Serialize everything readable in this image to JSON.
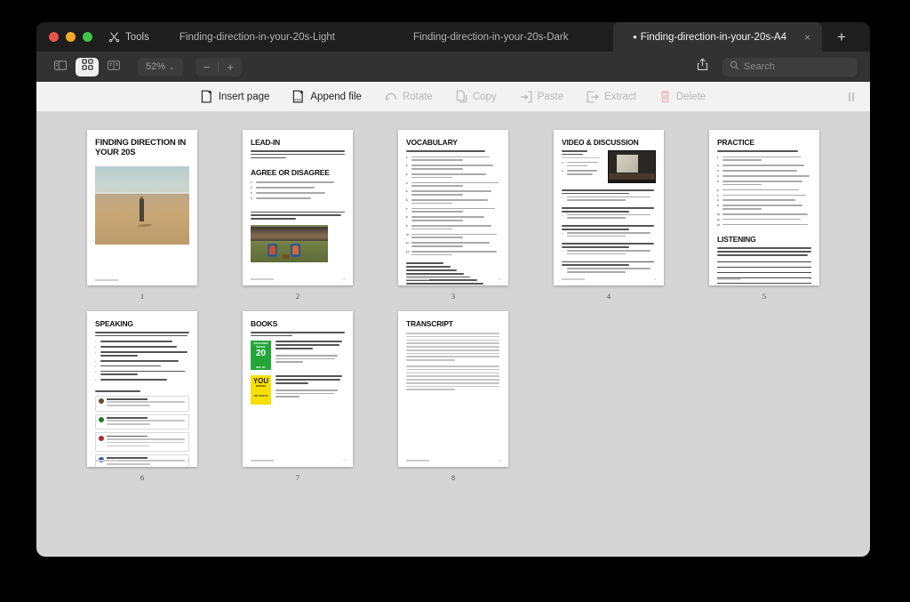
{
  "window": {
    "traffic_lights": [
      "close",
      "minimize",
      "maximize"
    ],
    "tools_label": "Tools"
  },
  "tabs": [
    {
      "label": "Finding-direction-in-your-20s-Light",
      "active": false,
      "dirty": false
    },
    {
      "label": "Finding-direction-in-your-20s-Dark",
      "active": false,
      "dirty": false
    },
    {
      "label": "Finding-direction-in-your-20s-A4",
      "active": true,
      "dirty": true,
      "dirty_marker": "•",
      "close_glyph": "×"
    }
  ],
  "new_tab_label": "+",
  "toolbar": {
    "sidebar_icon": "sidebar-icon",
    "grid_icon": "thumbnail-grid-icon",
    "split_icon": "split-view-icon",
    "zoom_level": "52%",
    "zoom_chevron": "⌄",
    "zoom_out": "−",
    "zoom_in": "+",
    "share_icon": "share-icon",
    "search_placeholder": "Search",
    "search_value": ""
  },
  "edit_toolbar": {
    "items": [
      {
        "label": "Insert page",
        "icon": "insert-page-icon",
        "enabled": true
      },
      {
        "label": "Append file",
        "icon": "append-file-icon",
        "enabled": true
      },
      {
        "label": "Rotate",
        "icon": "rotate-icon",
        "enabled": false
      },
      {
        "label": "Copy",
        "icon": "copy-icon",
        "enabled": false
      },
      {
        "label": "Paste",
        "icon": "paste-icon",
        "enabled": false
      },
      {
        "label": "Extract",
        "icon": "extract-icon",
        "enabled": false
      },
      {
        "label": "Delete",
        "icon": "trash-icon",
        "enabled": false
      }
    ]
  },
  "pages": [
    {
      "number": "1",
      "kind": "cover",
      "title": "FINDING DIRECTION IN YOUR 20S",
      "footer_right": ""
    },
    {
      "number": "2",
      "kind": "lead-in",
      "title": "LEAD-IN",
      "intro": "People often say that your 20s are the best years of your life, but do you think there's a specific age or decade that's truly the best? Why or why not?",
      "subtitle": "AGREE OR DISAGREE",
      "list": [
        "You should have your career path figured out by 25.",
        "Having fun in life is a sign of failure.",
        "Passion is more important than financial stability.",
        "Most people take having it all together."
      ],
      "outro": "Do you know someone who seems to have it all figured out? What do they do, and what makes you think they have everything together?",
      "footer_right": "2"
    },
    {
      "number": "3",
      "kind": "vocabulary",
      "title": "VOCABULARY",
      "instruction": "Match the highlighted keywords with their definitions.",
      "item_count": 12,
      "answer_count": 12,
      "footer_right": "3"
    },
    {
      "number": "4",
      "kind": "video",
      "title": "VIDEO & DISCUSSION",
      "video_title": "Feeling Lost in Your 20s",
      "duration": "Duration: 3:51 min",
      "tasks": [
        "Watch the video and focus on the new words.",
        "Discuss the statements and questions in the next task."
      ],
      "quote_count": 5,
      "footer_right": "4"
    },
    {
      "number": "5",
      "kind": "practice",
      "title": "PRACTICE",
      "instruction": "Replace the words in bold with the vocabulary from page 3",
      "item_count": 12,
      "subtitle": "LISTENING",
      "listening_text": "Listen to the audio extract and note the author's suggestions for handling feelings of being lost in your 20s. If necessary, listen 2-3 times. Afterward, review the next page and compare your notes.",
      "ruled_lines": 6,
      "footer_right": "5"
    },
    {
      "number": "6",
      "kind": "speaking",
      "title": "SPEAKING",
      "instruction": "Now, expand on the video's suggestions by sharing your own thoughts and examples from your life or those of people you know.",
      "bullets": [
        "Embrace feeling lost as a temporary part of your 20s.",
        "Use this time for self-discovery and exploring new passions.",
        "Try new skills, hobbies, meet people, and travel to learn more about yourself.",
        "Start projects and stay consistent, even if you procrastinate.",
        "Take risks; you have little to lose.",
        "Accept that people will come and go, making space for new relationships.",
        "Believe that everything happens for a reason."
      ],
      "comments_header": "Read and discuss the comments.",
      "comment_count": 4,
      "footer_right": "6"
    },
    {
      "number": "7",
      "kind": "books",
      "title": "BOOKS",
      "instruction": "If you enjoyed this lesson and want to explore further, check out the following books:",
      "books": [
        {
          "cover_brand": "THE DEFINING DECADE",
          "cover_number": "20",
          "cover_tag": "MEG JAY",
          "cover_color": "#23a638",
          "title": "\"The Defining Decade: Why Your Twenties Matter and How to Make the Most of Them Now\" by Meg Jay",
          "description": "Offers practical advice on making the most of your 20s and building a solid foundation for the future."
        },
        {
          "cover_brand": "YOU",
          "cover_number": "BADASS",
          "cover_tag": "JEN SINCERO",
          "cover_color": "#f5e000",
          "title": "\"You Are a Badass: How to Stop Doubting Your Greatness and Start Living an Awesome Life\" by Jen Sincero",
          "description": "Provides motivational advice and practical tips for improving self-confidence and achieving your goals."
        }
      ],
      "footer_right": "7"
    },
    {
      "number": "8",
      "kind": "transcript",
      "title": "TRANSCRIPT",
      "paragraph_1": "But don't worry, it will get better, or at least I hope so. It's important to accept and embrace the temporary feeling of being lost. Your 20s is the time of self-discovery and growth. Give yourself time to explore different options until you find something that you're passionate enough to pursue. Seek out new experiences and opportunities, whether it's learning new skills, trying new hobbies, meeting people, or traveling. With each new experience, you will learn more about yourself, the world around you, and have a clearer sense of purpose.",
      "paragraph_2": "If you're a big procrastinator like myself, imagine the potential that lies in starting something and staying consistent with it. This is also the time you can take on the most risk — you can go all in on something with almost nothing to lose, as you're still very young. Speaking about relationships, yes, people will be going in and out of your life. That's because they have their own story to write, with their own problems and struggles, just like you. But I believe that",
      "footer_right": "8"
    }
  ]
}
